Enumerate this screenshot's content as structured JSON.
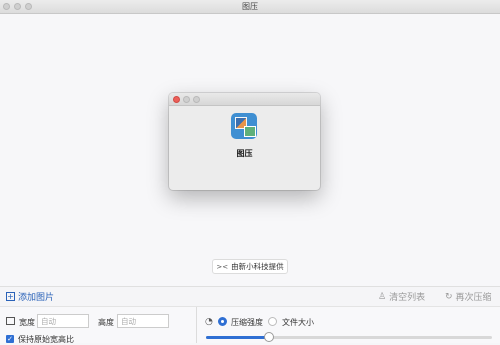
{
  "window": {
    "title": "图压"
  },
  "about": {
    "app_name": "图压"
  },
  "provider": {
    "icon": "xx-logo-icon",
    "label": "由新小科技提供"
  },
  "toolbar": {
    "add_label": "添加图片",
    "clear_label": "清空列表",
    "redo_label": "再次压缩"
  },
  "options": {
    "width_label": "宽度",
    "width_placeholder": "自动",
    "height_label": "高度",
    "height_placeholder": "自动",
    "keep_ratio_label": "保持原始宽高比",
    "mode_quality_label": "压缩强度",
    "mode_size_label": "文件大小",
    "strength_level": 0.22
  },
  "colors": {
    "accent": "#2f6fd3",
    "close": "#ec5f59"
  }
}
